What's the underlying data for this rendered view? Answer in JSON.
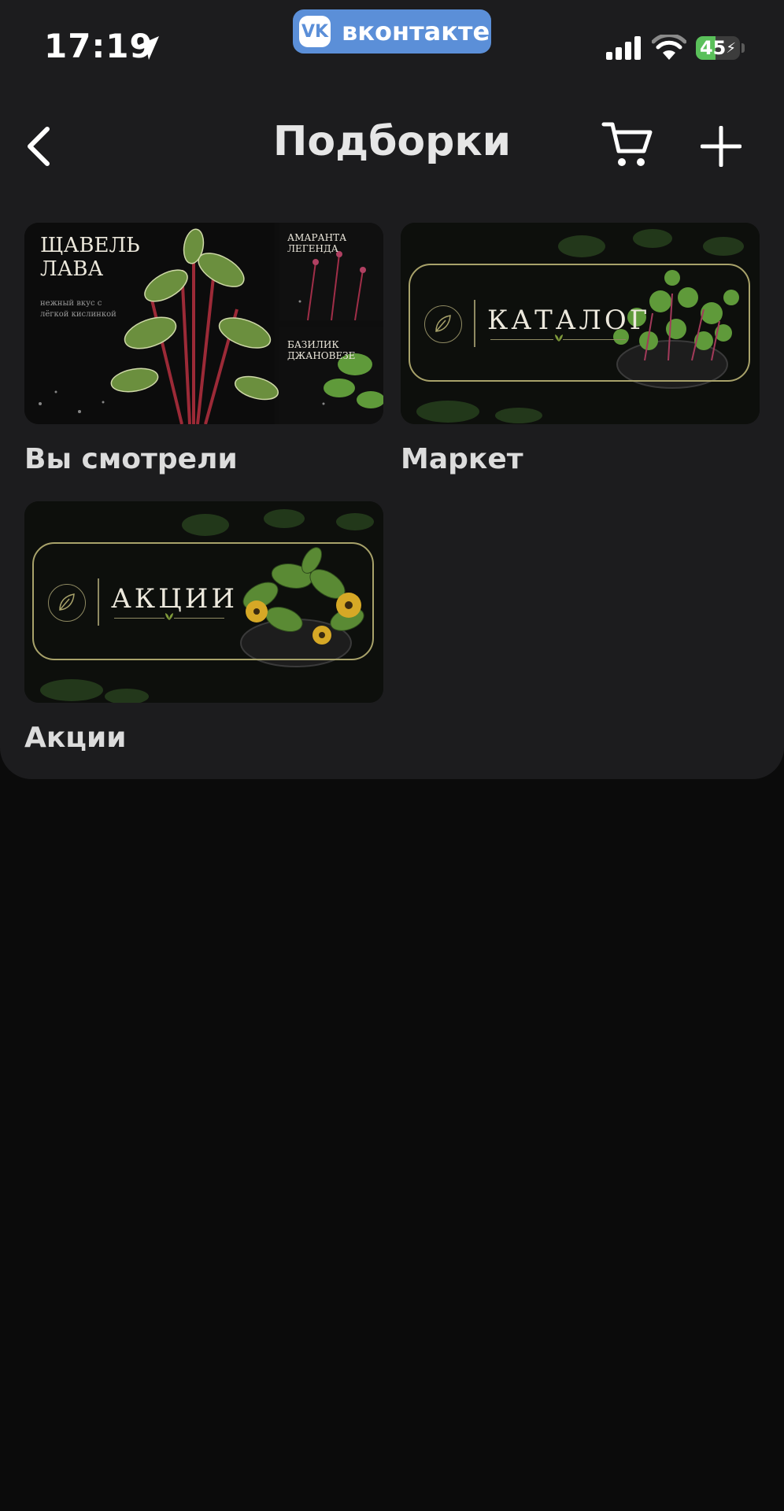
{
  "status_bar": {
    "time": "17:19",
    "app_pill": "вконтакте",
    "battery": "45",
    "battery_level": 0.45
  },
  "nav": {
    "title": "Подборки",
    "back_icon": "chevron-left-icon",
    "cart_icon": "cart-icon",
    "add_icon": "plus-icon"
  },
  "collections": [
    {
      "label": "Вы смотрели",
      "thumb_main_title": "ЩАВЕЛЬ ЛАВА",
      "thumb_main_sub": "нежный вкус с лёгкой кислинкой",
      "thumb_side_1": "АМАРАНТА ЛЕГЕНДА",
      "thumb_side_2": "БАЗИЛИК ДЖАНОВЕЗЕ"
    },
    {
      "label": "Маркет",
      "banner_word": "КАТАЛОГ"
    },
    {
      "label": "Акции",
      "banner_word": "АКЦИИ"
    }
  ],
  "colors": {
    "panel_bg": "#1c1c1e",
    "page_bg": "#0b0b0b",
    "vk_blue": "#5b8fd8",
    "banner_gold": "#a8a26a",
    "leaf_green": "#4e7a34"
  }
}
